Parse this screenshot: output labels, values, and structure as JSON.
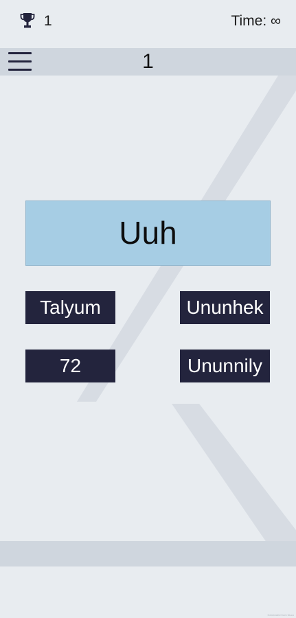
{
  "status": {
    "trophy_icon": "trophy-icon",
    "score": "1",
    "time_label": "Time: ∞"
  },
  "header": {
    "menu_icon": "hamburger-menu-icon",
    "level": "1"
  },
  "question": {
    "symbol": "Uuh"
  },
  "answers": [
    {
      "label": "Talyum"
    },
    {
      "label": "Ununhek"
    },
    {
      "label": "72"
    },
    {
      "label": "Ununnily"
    }
  ],
  "footer": {
    "watermark": "Generated from Nuco"
  },
  "colors": {
    "background": "#e8ecf0",
    "band": "#cfd6de",
    "prompt_card": "#a6cde4",
    "answer_button": "#23243d",
    "answer_text": "#ffffff"
  }
}
